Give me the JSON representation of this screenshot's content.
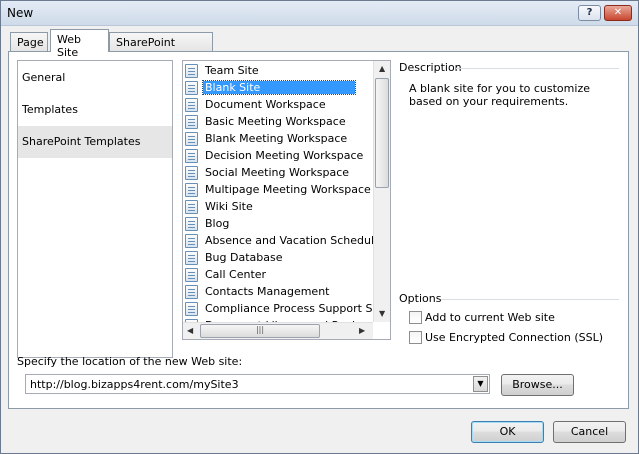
{
  "window": {
    "title": "New",
    "help_icon": "question-icon",
    "close_icon": "close-icon"
  },
  "tabs": [
    {
      "label": "Page"
    },
    {
      "label": "Web Site"
    },
    {
      "label": "SharePoint Content"
    }
  ],
  "categories": [
    {
      "label": "General"
    },
    {
      "label": "Templates"
    },
    {
      "label": "SharePoint Templates"
    }
  ],
  "templates": [
    {
      "label": "Team Site"
    },
    {
      "label": "Blank Site"
    },
    {
      "label": "Document Workspace"
    },
    {
      "label": "Basic Meeting Workspace"
    },
    {
      "label": "Blank Meeting Workspace"
    },
    {
      "label": "Decision Meeting Workspace"
    },
    {
      "label": "Social Meeting Workspace"
    },
    {
      "label": "Multipage Meeting Workspace"
    },
    {
      "label": "Wiki Site"
    },
    {
      "label": "Blog"
    },
    {
      "label": "Absence and Vacation Schedule"
    },
    {
      "label": "Bug Database"
    },
    {
      "label": "Call Center"
    },
    {
      "label": "Contacts Management"
    },
    {
      "label": "Compliance Process Support Site"
    },
    {
      "label": "Document Library and Review"
    }
  ],
  "description": {
    "title": "Description",
    "text": "A blank site for you to customize based on your requirements."
  },
  "options": {
    "title": "Options",
    "add_to_current": "Add to current Web site",
    "use_ssl": "Use Encrypted Connection (SSL)"
  },
  "location": {
    "label": "Specify the location of the new Web site:",
    "value": "http://blog.bizapps4rent.com/mySite3",
    "browse": "Browse..."
  },
  "buttons": {
    "ok": "OK",
    "cancel": "Cancel"
  }
}
